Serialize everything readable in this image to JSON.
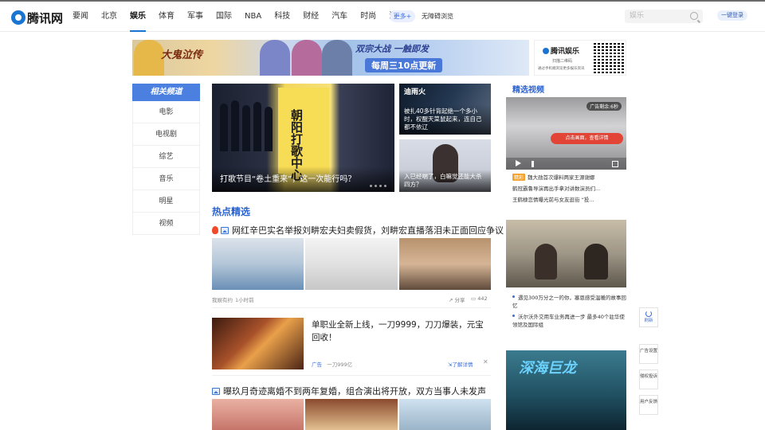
{
  "nav": {
    "logo": "腾讯网",
    "items": [
      "要闻",
      "北京",
      "娱乐",
      "体育",
      "军事",
      "国际",
      "NBA",
      "科技",
      "财经",
      "汽车",
      "时尚",
      "游戏"
    ],
    "active_index": 2,
    "more": "更多+",
    "barrier_free": "无障碍浏览",
    "search_placeholder": "娱乐",
    "login": "一键登录"
  },
  "banner": {
    "game_title": "大鬼泣传",
    "slogan": "双宗大战 一触即发",
    "update": "每周三10点更新",
    "qr_brand": "腾讯娱乐",
    "qr_line1": "扫描二维码",
    "qr_line2": "通过手机端浏览更多娱乐资讯"
  },
  "side": {
    "head": "相关频道",
    "items": [
      "电影",
      "电视剧",
      "综艺",
      "音乐",
      "明星",
      "视频"
    ]
  },
  "hero": {
    "poster_text": "朝阳打歌中心",
    "caption": "打歌节目“卷土重来”，这一次能行吗？"
  },
  "cards": {
    "c1": "被扎40多针背起绝一个多小时，权醒天菜鼠起来，连自己都不依辽",
    "c1_tag": "迪雨火",
    "c2": "入已经喘了，白嘛觉还能大杀四方？"
  },
  "hot": {
    "section": "热点精选",
    "news1": "网红辛巴实名举报刘畊宏夫妇卖假货，刘畊宏直播落泪未正面回应争议",
    "news1_source": "我娱有约",
    "news1_time": "1小时前",
    "share": "分享",
    "comments": "442",
    "ad_title": "单职业全新上线，一刀9999，刀刀爆装，元宝回收！",
    "ad_label": "广告",
    "ad_brand": "一刀999亿",
    "ad_detail": "了解详情",
    "news2": "曝玖月奇迹离婚不到两年复婚，组合演出将开放，双方当事人未发声"
  },
  "right": {
    "featured": "精选视频",
    "video_ad": "广告剩余:6秒",
    "video_cta": "点击画面，查看详情",
    "vlist": [
      {
        "tag": "精彩",
        "text": "魏大勋首次爆料两家王源谢娜 "
      },
      {
        "tag": "",
        "text": "鹤冠霸鲁导演再出手拿对讲数演员们..."
      },
      {
        "tag": "",
        "text": "王鹤棣恋情曝光前与女友逛街 “投..."
      }
    ],
    "rlist": [
      "遇见300万分之一的你，塞恩感受温暖的故事回忆",
      "沃尔沃外交用车业务再进一步 最多40个驻华使领馆及国际组"
    ],
    "poster_title": "深海巨龙"
  },
  "float": {
    "refresh": "刷新",
    "ad": "广告设置",
    "report": "侵权投诉",
    "feedback": "用户反馈"
  }
}
